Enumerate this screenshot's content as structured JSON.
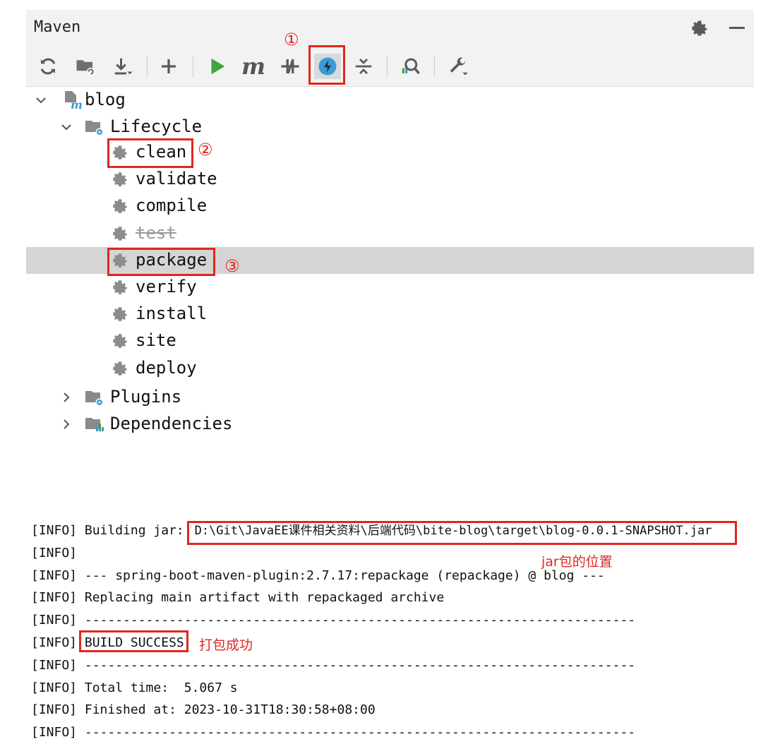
{
  "window": {
    "title": "Maven"
  },
  "toolbar": {
    "buttons": [
      {
        "name": "reload-icon"
      },
      {
        "name": "generate-sources-icon"
      },
      {
        "name": "download-icon"
      },
      {
        "name": "add-icon"
      },
      {
        "name": "run-icon"
      },
      {
        "name": "execute-goal-icon",
        "glyph": "m"
      },
      {
        "name": "toggle-offline-icon"
      },
      {
        "name": "skip-tests-icon"
      },
      {
        "name": "collapse-all-icon"
      },
      {
        "name": "analyze-dependencies-icon"
      },
      {
        "name": "settings-wrench-icon"
      }
    ]
  },
  "annotations": {
    "step1": "①",
    "step2": "②",
    "step3": "③",
    "jar_location": "jar包的位置",
    "build_ok": "打包成功"
  },
  "tree": {
    "project": "blog",
    "lifecycle": "Lifecycle",
    "goals": [
      "clean",
      "validate",
      "compile",
      "test",
      "package",
      "verify",
      "install",
      "site",
      "deploy"
    ],
    "plugins": "Plugins",
    "dependencies": "Dependencies"
  },
  "console": {
    "lines": [
      {
        "prefix": "[INFO] ",
        "text": "Building jar: ",
        "path": "D:\\Git\\JavaEE课件相关资料\\后端代码\\bite-blog\\target\\blog-0.0.1-SNAPSHOT.jar"
      },
      {
        "prefix": "[INFO]",
        "text": ""
      },
      {
        "prefix": "[INFO] ",
        "text": "--- spring-boot-maven-plugin:2.7.17:repackage (repackage) @ blog ---"
      },
      {
        "prefix": "[INFO] ",
        "text": "Replacing main artifact with repackaged archive"
      },
      {
        "prefix": "[INFO] ",
        "text": "------------------------------------------------------------------------"
      },
      {
        "prefix": "[INFO] ",
        "text": "BUILD SUCCESS"
      },
      {
        "prefix": "[INFO] ",
        "text": "------------------------------------------------------------------------"
      },
      {
        "prefix": "[INFO] ",
        "text": "Total time:  5.067 s"
      },
      {
        "prefix": "[INFO] ",
        "text": "Finished at: 2023-10-31T18:30:58+08:00"
      },
      {
        "prefix": "[INFO] ",
        "text": "------------------------------------------------------------------------"
      }
    ]
  },
  "colors": {
    "annotation_red": "#e0261f",
    "selected_row": "#d5d5d5",
    "run_green": "#3fa63f",
    "offline_blue": "#3c9ad6"
  }
}
